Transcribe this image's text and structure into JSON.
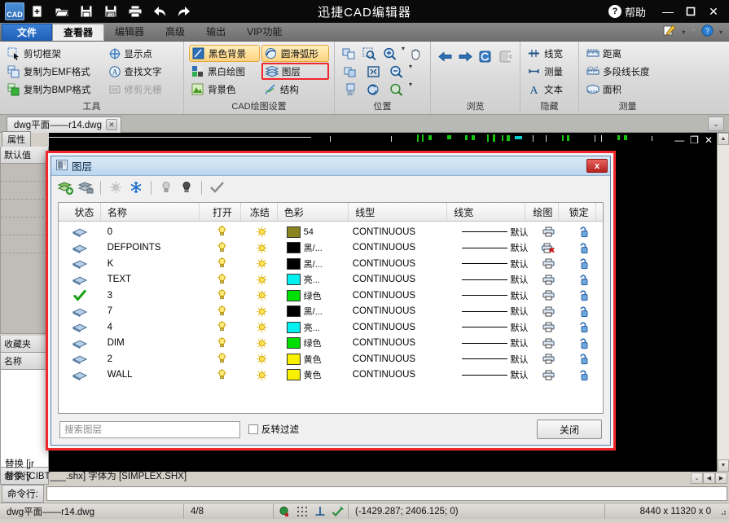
{
  "titlebar": {
    "app_title": "迅捷CAD编辑器",
    "logo": "CAD",
    "help_label": "帮助",
    "quick_access": [
      {
        "name": "new-file-icon",
        "label": "新建"
      },
      {
        "name": "open-file-icon",
        "label": "打开"
      },
      {
        "name": "save-file-icon",
        "label": "保存"
      },
      {
        "name": "save-pdf-icon",
        "label": "另存为PDF"
      },
      {
        "name": "print-icon",
        "label": "打印"
      },
      {
        "name": "undo-icon",
        "label": "撤销"
      },
      {
        "name": "redo-icon",
        "label": "重做"
      }
    ],
    "minimize": "—",
    "maximize": "❐",
    "close": "✕"
  },
  "menubar": {
    "tabs": [
      {
        "label": "文件",
        "state": "file"
      },
      {
        "label": "查看器",
        "state": "active"
      },
      {
        "label": "编辑器",
        "state": "plain"
      },
      {
        "label": "高级",
        "state": "plain"
      },
      {
        "label": "输出",
        "state": "plain"
      },
      {
        "label": "VIP功能",
        "state": "plain"
      }
    ]
  },
  "ribbon": {
    "groups": [
      {
        "label": "工具",
        "col1": [
          {
            "label": "剪切框架",
            "icon": "crop-frame-icon",
            "state": "normal"
          },
          {
            "label": "复制为EMF格式",
            "icon": "copy-emf-icon",
            "state": "normal"
          },
          {
            "label": "复制为BMP格式",
            "icon": "copy-bmp-icon",
            "state": "normal"
          }
        ],
        "col2": [
          {
            "label": "显示点",
            "icon": "show-points-icon",
            "state": "normal"
          },
          {
            "label": "查找文字",
            "icon": "find-text-icon",
            "state": "normal"
          },
          {
            "label": "修剪光栅",
            "icon": "trim-raster-icon",
            "state": "disabled"
          }
        ]
      },
      {
        "label": "CAD绘图设置",
        "col1": [
          {
            "label": "黑色背景",
            "icon": "black-background-icon",
            "state": "highlight"
          },
          {
            "label": "黑白绘图",
            "icon": "bw-drawing-icon",
            "state": "normal"
          },
          {
            "label": "背景色",
            "icon": "background-color-icon",
            "state": "normal"
          }
        ],
        "col2": [
          {
            "label": "圆滑弧形",
            "icon": "smooth-arc-icon",
            "state": "highlight"
          },
          {
            "label": "图层",
            "icon": "layers-icon",
            "state": "boxed"
          },
          {
            "label": "结构",
            "icon": "structure-icon",
            "state": "normal"
          }
        ]
      },
      {
        "label": "位置",
        "icons": [
          [
            "pan-window-icon",
            "zoom-window-icon",
            "zoom-in-icon",
            "hand-pan-icon"
          ],
          [
            "fit-window-icon",
            "zoom-extents-icon",
            "zoom-out-icon"
          ],
          [
            "rotate-35-icon",
            "zoom-previous-icon",
            "zoom-dynamic-icon"
          ]
        ]
      },
      {
        "label": "浏览",
        "icons": [
          [
            "back-arrow-icon",
            "forward-arrow-icon",
            "refresh-view-icon",
            "restore-view-icon"
          ]
        ]
      },
      {
        "label": "隐藏",
        "col1": [
          {
            "label": "线宽",
            "icon": "lineweight-icon",
            "state": "normal"
          },
          {
            "label": "测量",
            "icon": "measure-hide-icon",
            "state": "normal"
          },
          {
            "label": "文本",
            "icon": "text-hide-icon",
            "state": "normal"
          }
        ]
      },
      {
        "label": "测量",
        "col1": [
          {
            "label": "距离",
            "icon": "distance-icon",
            "state": "normal"
          },
          {
            "label": "多段线长度",
            "icon": "polyline-length-icon",
            "state": "normal"
          },
          {
            "label": "面积",
            "icon": "area-icon",
            "state": "normal"
          }
        ]
      }
    ]
  },
  "workspace": {
    "doc_tab": "dwg平面——r14.dwg",
    "tab_close": "✕",
    "tab_chevron": "⌄",
    "canvas_minimize": "—",
    "canvas_maximize": "❐",
    "canvas_close": "✕"
  },
  "sidebar": {
    "properties_tab": "属性",
    "default_value": "默认值",
    "favorites": "收藏夹",
    "name_header": "名称",
    "command_header": "命令行"
  },
  "dialog": {
    "title": "图层",
    "close_x": "x",
    "toolbar": [
      {
        "name": "new-layer-icon",
        "tip": "新建图层"
      },
      {
        "name": "delete-layer-icon",
        "tip": "删除图层"
      },
      {
        "name": "thaw-all-icon",
        "tip": "解冻"
      },
      {
        "name": "freeze-icon",
        "tip": "冻结"
      },
      {
        "name": "light-off-icon",
        "tip": "关闭"
      },
      {
        "name": "light-on-icon",
        "tip": "打开"
      },
      {
        "name": "apply-check-icon",
        "tip": "应用"
      }
    ],
    "columns": [
      "状态",
      "名称",
      "打开",
      "冻结",
      "色彩",
      "线型",
      "线宽",
      "绘图",
      "锁定"
    ],
    "rows": [
      {
        "state": "layer",
        "name": "0",
        "open": "on",
        "freeze": "on",
        "color_hex": "#898420",
        "color_name": "54",
        "ltype": "CONTINUOUS",
        "lwt": "默认",
        "plot": "yes",
        "lock": "unlocked"
      },
      {
        "state": "layer",
        "name": "DEFPOINTS",
        "open": "on",
        "freeze": "on",
        "color_hex": "#000000",
        "color_name": "黑/...",
        "ltype": "CONTINUOUS",
        "lwt": "默认",
        "plot": "no",
        "lock": "unlocked"
      },
      {
        "state": "layer",
        "name": "K",
        "open": "on",
        "freeze": "on",
        "color_hex": "#000000",
        "color_name": "黑/...",
        "ltype": "CONTINUOUS",
        "lwt": "默认",
        "plot": "yes",
        "lock": "unlocked"
      },
      {
        "state": "layer",
        "name": "TEXT",
        "open": "on",
        "freeze": "on",
        "color_hex": "#00f0f0",
        "color_name": "亮...",
        "ltype": "CONTINUOUS",
        "lwt": "默认",
        "plot": "yes",
        "lock": "unlocked"
      },
      {
        "state": "current",
        "name": "3",
        "open": "on",
        "freeze": "on",
        "color_hex": "#00e000",
        "color_name": "绿色",
        "ltype": "CONTINUOUS",
        "lwt": "默认",
        "plot": "yes",
        "lock": "unlocked"
      },
      {
        "state": "layer",
        "name": "7",
        "open": "on",
        "freeze": "on",
        "color_hex": "#000000",
        "color_name": "黑/...",
        "ltype": "CONTINUOUS",
        "lwt": "默认",
        "plot": "yes",
        "lock": "unlocked"
      },
      {
        "state": "layer",
        "name": "4",
        "open": "on",
        "freeze": "on",
        "color_hex": "#00f0f0",
        "color_name": "亮...",
        "ltype": "CONTINUOUS",
        "lwt": "默认",
        "plot": "yes",
        "lock": "unlocked"
      },
      {
        "state": "layer",
        "name": "DIM",
        "open": "on",
        "freeze": "on",
        "color_hex": "#00e000",
        "color_name": "绿色",
        "ltype": "CONTINUOUS",
        "lwt": "默认",
        "plot": "yes",
        "lock": "unlocked"
      },
      {
        "state": "layer",
        "name": "2",
        "open": "on",
        "freeze": "on",
        "color_hex": "#f8f000",
        "color_name": "黄色",
        "ltype": "CONTINUOUS",
        "lwt": "默认",
        "plot": "yes",
        "lock": "unlocked"
      },
      {
        "state": "layer",
        "name": "WALL",
        "open": "on",
        "freeze": "on",
        "color_hex": "#f8f000",
        "color_name": "黄色",
        "ltype": "CONTINUOUS",
        "lwt": "默认",
        "plot": "yes",
        "lock": "unlocked"
      }
    ],
    "search_placeholder": "搜索图层",
    "invert_filter": "反转过滤",
    "invert_checked": false,
    "close_button": "关闭"
  },
  "command": {
    "history_line_1": "替换 [jr",
    "history_line_2": "替换 [CIBT___.shx] 字体为 [SIMPLEX.SHX]",
    "label": "命令行:",
    "value": ""
  },
  "statusbar": {
    "filename": "dwg平面——r14.dwg",
    "page": "4/8",
    "coordinates": "(-1429.287; 2406.125; 0)",
    "dimensions": "8440 x 11320 x 0"
  }
}
